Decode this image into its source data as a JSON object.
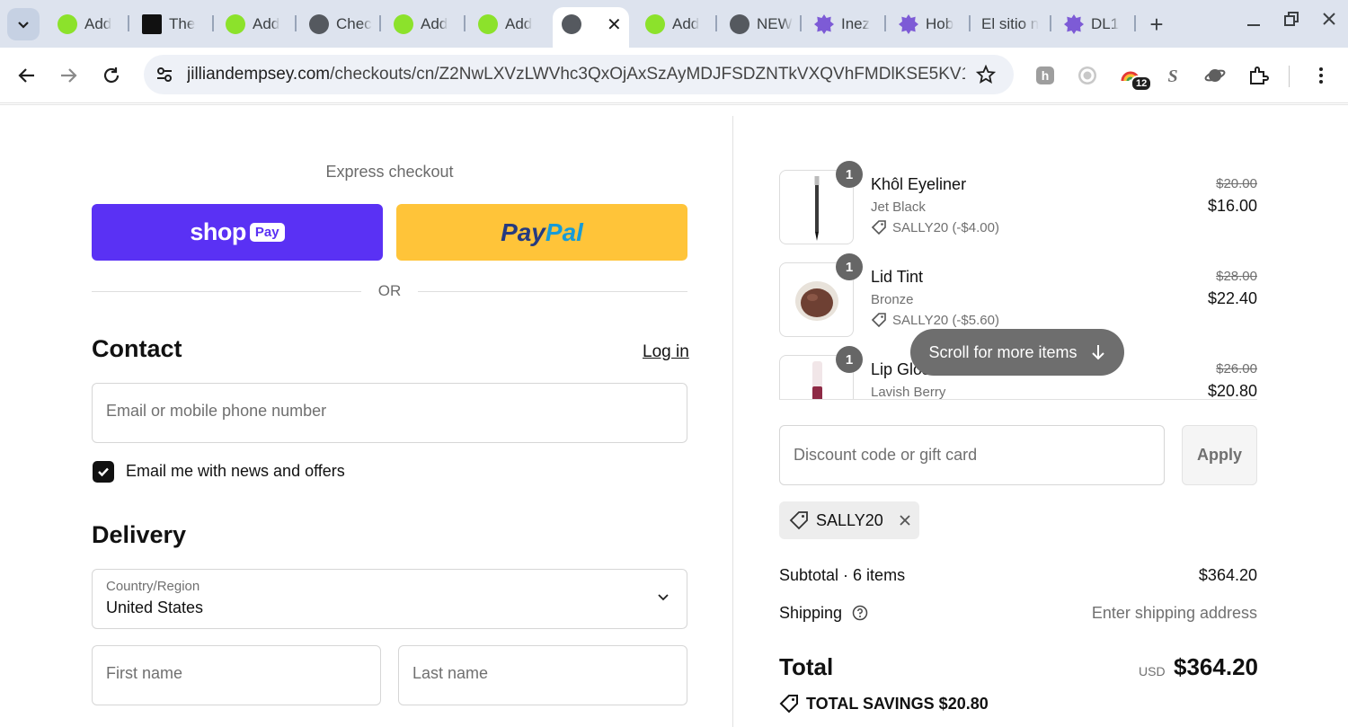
{
  "browser": {
    "tabs": [
      {
        "label": "Add",
        "favicon": "check-logo-icon"
      },
      {
        "label": "The",
        "favicon": "brand-logo-icon"
      },
      {
        "label": "Add",
        "favicon": "check-logo-icon"
      },
      {
        "label": "Chec",
        "favicon": "globe-icon"
      },
      {
        "label": "Add",
        "favicon": "check-logo-icon"
      },
      {
        "label": "Add",
        "favicon": "check-logo-icon"
      },
      {
        "label": "",
        "favicon": "globe-icon",
        "active": true
      },
      {
        "label": "Add",
        "favicon": "check-logo-icon"
      },
      {
        "label": "NEW",
        "favicon": "globe-icon"
      },
      {
        "label": "Inez",
        "favicon": "badge-logo-icon"
      },
      {
        "label": "Hob",
        "favicon": "badge-logo-icon"
      },
      {
        "label": "El sitio n",
        "favicon": ""
      },
      {
        "label": "DL1",
        "favicon": "badge-logo-icon"
      }
    ],
    "url_host": "jilliandempsey.com",
    "url_path": "/checkouts/cn/Z2NwLXVzLWVhc3QxOjAxSzAyMDJFSDZNTkVXQVhFMDlKSE5KV1B…",
    "extension_badge": "12"
  },
  "checkout": {
    "express_label": "Express checkout",
    "shoppay_word": "shop",
    "shoppay_badge": "Pay",
    "paypal_a": "Pay",
    "paypal_b": "Pal",
    "or_label": "OR",
    "contact_heading": "Contact",
    "login_label": "Log in",
    "email_placeholder": "Email or mobile phone number",
    "news_label": "Email me with news and offers",
    "news_checked": true,
    "delivery_heading": "Delivery",
    "country_label": "Country/Region",
    "country_value": "United States",
    "first_name_placeholder": "First name",
    "last_name_placeholder": "Last name"
  },
  "summary": {
    "items": [
      {
        "qty": "1",
        "name": "Khôl Eyeliner",
        "variant": "Jet Black",
        "discount": "SALLY20 (-$4.00)",
        "old_price": "$20.00",
        "price": "$16.00"
      },
      {
        "qty": "1",
        "name": "Lid Tint",
        "variant": "Bronze",
        "discount": "SALLY20 (-$5.60)",
        "old_price": "$28.00",
        "price": "$22.40"
      },
      {
        "qty": "1",
        "name": "Lip Gloss",
        "variant": "Lavish Berry",
        "discount": "",
        "old_price": "$26.00",
        "price": "$20.80"
      }
    ],
    "scroll_hint": "Scroll for more items",
    "discount_placeholder": "Discount code or gift card",
    "apply_label": "Apply",
    "applied_code": "SALLY20",
    "subtotal_label": "Subtotal · 6 items",
    "subtotal_value": "$364.20",
    "shipping_label": "Shipping",
    "shipping_value": "Enter shipping address",
    "total_label": "Total",
    "currency": "USD",
    "total_value": "$364.20",
    "savings_label": "TOTAL SAVINGS $20.80"
  },
  "colors": {
    "shoppay": "#5a31f4",
    "paypal": "#ffc439",
    "tabbar": "#dde3ee"
  }
}
